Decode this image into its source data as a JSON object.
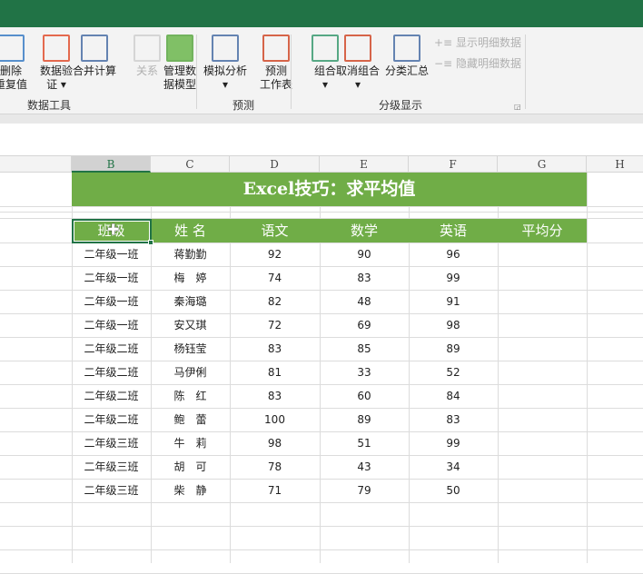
{
  "ribbon": {
    "buttons": [
      {
        "l1": "删除",
        "l2": "重复值"
      },
      {
        "l1": "数据验",
        "l2": "证 ▾"
      },
      {
        "l1": "合并计算",
        "l2": ""
      },
      {
        "l1": "关系",
        "l2": ""
      },
      {
        "l1": "管理数",
        "l2": "据模型"
      },
      {
        "l1": "模拟分析",
        "l2": "▾"
      },
      {
        "l1": "预测",
        "l2": "工作表"
      },
      {
        "l1": "组合",
        "l2": "▾"
      },
      {
        "l1": "取消组合",
        "l2": "▾"
      },
      {
        "l1": "分类汇总",
        "l2": ""
      }
    ],
    "show_detail": "显示明细数据",
    "hide_detail": "隐藏明细数据",
    "groups": {
      "data_tools": "数据工具",
      "forecast": "预测",
      "outline": "分级显示"
    }
  },
  "columns": [
    "B",
    "C",
    "D",
    "E",
    "F",
    "G",
    "H"
  ],
  "sheet": {
    "title": "Excel技巧：求平均值",
    "headers": [
      "班级",
      "姓 名",
      "语文",
      "数学",
      "英语",
      "平均分"
    ],
    "rows": [
      [
        "二年级一班",
        "蒋勤勤",
        "92",
        "90",
        "96"
      ],
      [
        "二年级一班",
        "梅　婷",
        "74",
        "83",
        "99"
      ],
      [
        "二年级一班",
        "秦海璐",
        "82",
        "48",
        "91"
      ],
      [
        "二年级一班",
        "安又琪",
        "72",
        "69",
        "98"
      ],
      [
        "二年级二班",
        "杨钰莹",
        "83",
        "85",
        "89"
      ],
      [
        "二年级二班",
        "马伊俐",
        "81",
        "33",
        "52"
      ],
      [
        "二年级二班",
        "陈　红",
        "83",
        "60",
        "84"
      ],
      [
        "二年级二班",
        "鲍　蕾",
        "100",
        "89",
        "83"
      ],
      [
        "二年级三班",
        "牛　莉",
        "98",
        "51",
        "99"
      ],
      [
        "二年级三班",
        "胡　可",
        "78",
        "43",
        "34"
      ],
      [
        "二年级三班",
        "柴　静",
        "71",
        "79",
        "50"
      ]
    ]
  }
}
